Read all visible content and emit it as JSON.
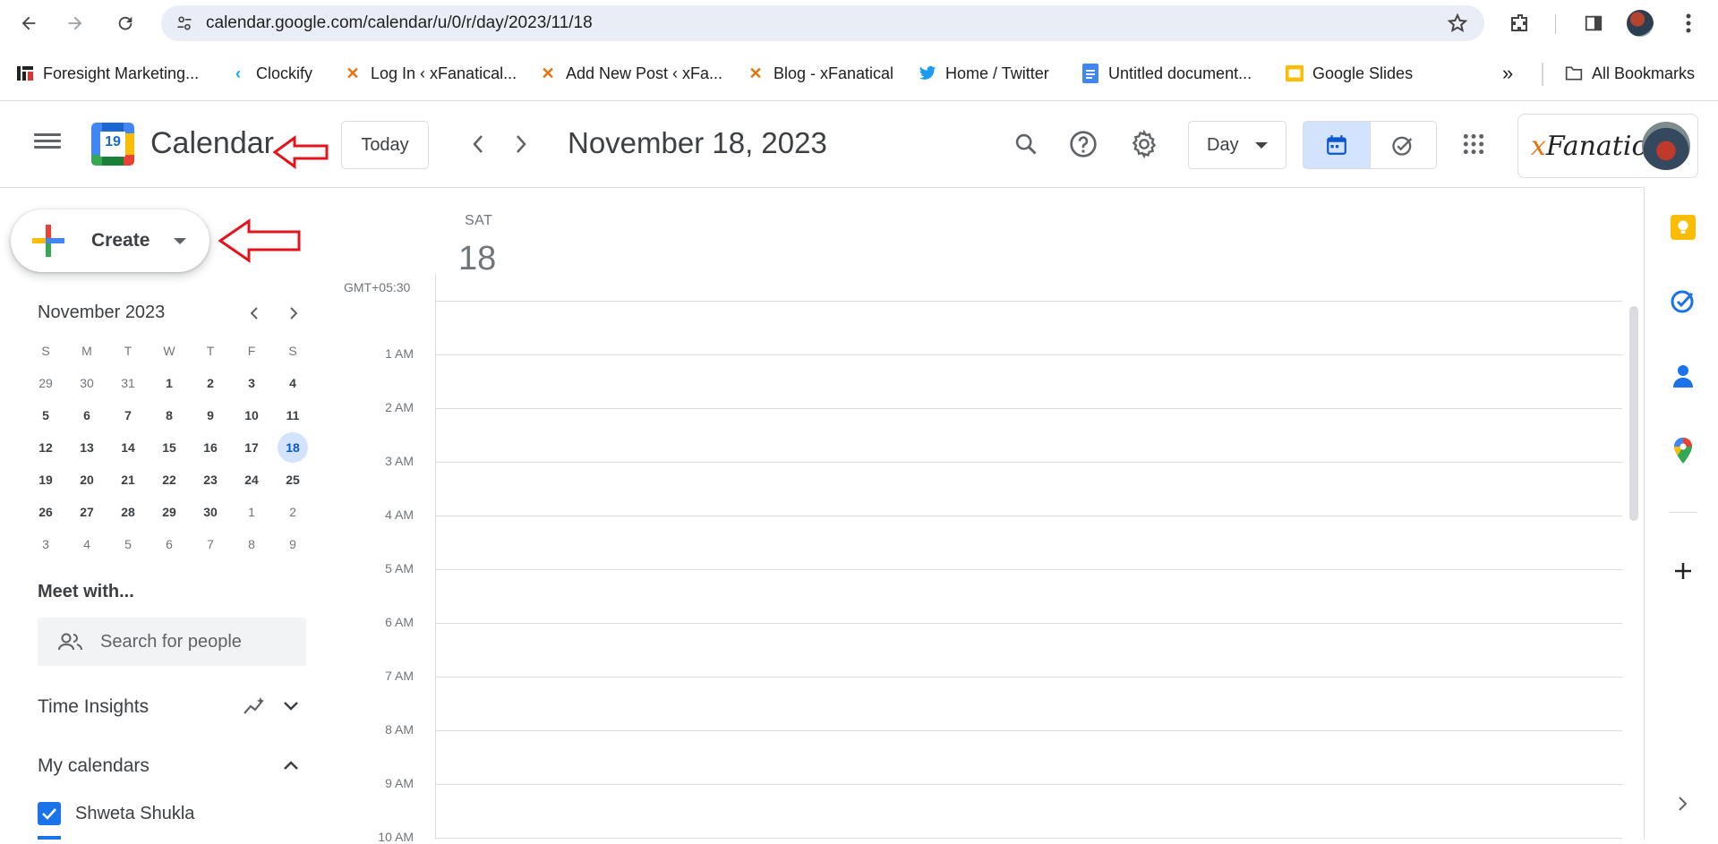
{
  "browser": {
    "url": "calendar.google.com/calendar/u/0/r/day/2023/11/18",
    "icons": [
      "back-icon",
      "forward-icon",
      "reload-icon",
      "site-settings-icon",
      "star-icon",
      "extensions-icon",
      "side-panel-icon",
      "profile-avatar",
      "menu-icon"
    ]
  },
  "bookmarks": [
    {
      "label": "Foresight Marketing...",
      "icon": "foresight-icon"
    },
    {
      "label": "Clockify",
      "icon": "clockify-icon"
    },
    {
      "label": "Log In ‹ xFanatical...",
      "icon": "xfanatical-icon"
    },
    {
      "label": "Add New Post ‹ xFa...",
      "icon": "xfanatical-icon"
    },
    {
      "label": "Blog - xFanatical",
      "icon": "xfanatical-icon"
    },
    {
      "label": "Home / Twitter",
      "icon": "twitter-icon"
    },
    {
      "label": "Untitled document...",
      "icon": "docs-icon"
    },
    {
      "label": "Google Slides",
      "icon": "slides-icon"
    }
  ],
  "bookmarks_overflow": "»",
  "all_bookmarks": "All Bookmarks",
  "header": {
    "app_name": "Calendar",
    "logo_day": "19",
    "today_label": "Today",
    "date_title": "November 18, 2023",
    "view_label": "Day",
    "brand_text_x": "x",
    "brand_text_rest": "Fanatical"
  },
  "sidebar": {
    "create_label": "Create",
    "mini_month": "November 2023",
    "dow": [
      "S",
      "M",
      "T",
      "W",
      "T",
      "F",
      "S"
    ],
    "weeks": [
      [
        [
          "29",
          "other"
        ],
        [
          "30",
          "other"
        ],
        [
          "31",
          "other"
        ],
        [
          "1",
          "cur"
        ],
        [
          "2",
          "cur"
        ],
        [
          "3",
          "cur"
        ],
        [
          "4",
          "cur"
        ]
      ],
      [
        [
          "5",
          "cur"
        ],
        [
          "6",
          "cur"
        ],
        [
          "7",
          "cur"
        ],
        [
          "8",
          "cur"
        ],
        [
          "9",
          "cur"
        ],
        [
          "10",
          "cur"
        ],
        [
          "11",
          "cur"
        ]
      ],
      [
        [
          "12",
          "cur"
        ],
        [
          "13",
          "cur"
        ],
        [
          "14",
          "cur"
        ],
        [
          "15",
          "cur"
        ],
        [
          "16",
          "cur"
        ],
        [
          "17",
          "cur"
        ],
        [
          "18",
          "sel"
        ]
      ],
      [
        [
          "19",
          "cur"
        ],
        [
          "20",
          "cur"
        ],
        [
          "21",
          "cur"
        ],
        [
          "22",
          "cur"
        ],
        [
          "23",
          "cur"
        ],
        [
          "24",
          "cur"
        ],
        [
          "25",
          "cur"
        ]
      ],
      [
        [
          "26",
          "cur"
        ],
        [
          "27",
          "cur"
        ],
        [
          "28",
          "cur"
        ],
        [
          "29",
          "cur"
        ],
        [
          "30",
          "cur"
        ],
        [
          "1",
          "other"
        ],
        [
          "2",
          "other"
        ]
      ],
      [
        [
          "3",
          "other"
        ],
        [
          "4",
          "other"
        ],
        [
          "5",
          "other"
        ],
        [
          "6",
          "other"
        ],
        [
          "7",
          "other"
        ],
        [
          "8",
          "other"
        ],
        [
          "9",
          "other"
        ]
      ]
    ],
    "meet_title": "Meet with...",
    "people_placeholder": "Search for people",
    "time_insights": "Time Insights",
    "my_calendars": "My calendars",
    "calendar_name": "Shweta Shukla"
  },
  "day_view": {
    "dow": "SAT",
    "day_num": "18",
    "timezone": "GMT+05:30",
    "hours": [
      "1 AM",
      "2 AM",
      "3 AM",
      "4 AM",
      "5 AM",
      "6 AM",
      "7 AM",
      "8 AM",
      "9 AM",
      "10 AM"
    ]
  },
  "side_panel_icons": [
    "keep-icon",
    "tasks-icon",
    "contacts-icon",
    "maps-icon",
    "add-icon",
    "expand-panel-icon"
  ],
  "colors": {
    "accent_blue": "#1a73e8",
    "selected_bg": "#d3e3fd",
    "annotation_red": "#e3141b"
  }
}
